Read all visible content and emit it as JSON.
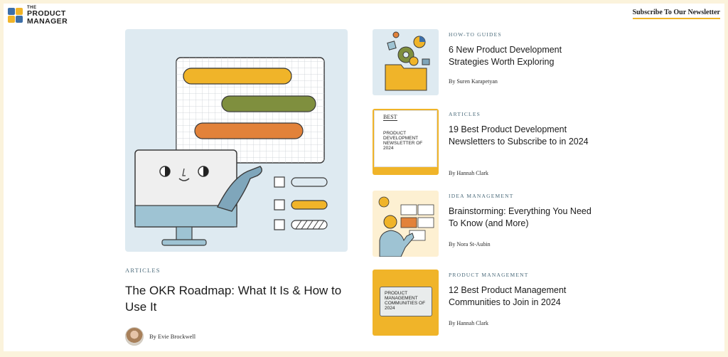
{
  "header": {
    "logo_the": "THE",
    "logo_line1": "PRODUCT",
    "logo_line2": "MANAGER",
    "subscribe_label": "Subscribe To Our Newsletter"
  },
  "featured": {
    "category": "ARTICLES",
    "title": "The OKR Roadmap: What It Is & How to Use It",
    "author": "By Evie Brockwell"
  },
  "articles": [
    {
      "category": "HOW-TO GUIDES",
      "title": "6 New Product Development Strategies Worth Exploring",
      "author": "By Suren Karapetyan"
    },
    {
      "category": "ARTICLES",
      "title": "19 Best Product Development Newsletters to Subscribe to in 2024",
      "author": "By Hannah Clark",
      "thumb_best": "BEST",
      "thumb_text": "PRODUCT DEVELOPMENT NEWSLETTER OF 2024"
    },
    {
      "category": "IDEA MANAGEMENT",
      "title": "Brainstorming: Everything You Need To Know (and More)",
      "author": "By Nora St-Aubin"
    },
    {
      "category": "PRODUCT MANAGEMENT",
      "title": "12 Best Product Management Communities to Join in 2024",
      "author": "By Hannah Clark",
      "thumb_text": "PRODUCT MANAGEMENT COMMUNITIES OF 2024"
    }
  ],
  "colors": {
    "page_bg": "#fbf3dc",
    "accent_yellow": "#f0b429",
    "accent_green": "#7f8f3e",
    "accent_orange": "#e2823a",
    "brand_blue": "#3d6fa8",
    "illustration_bg": "#deeaf1"
  }
}
